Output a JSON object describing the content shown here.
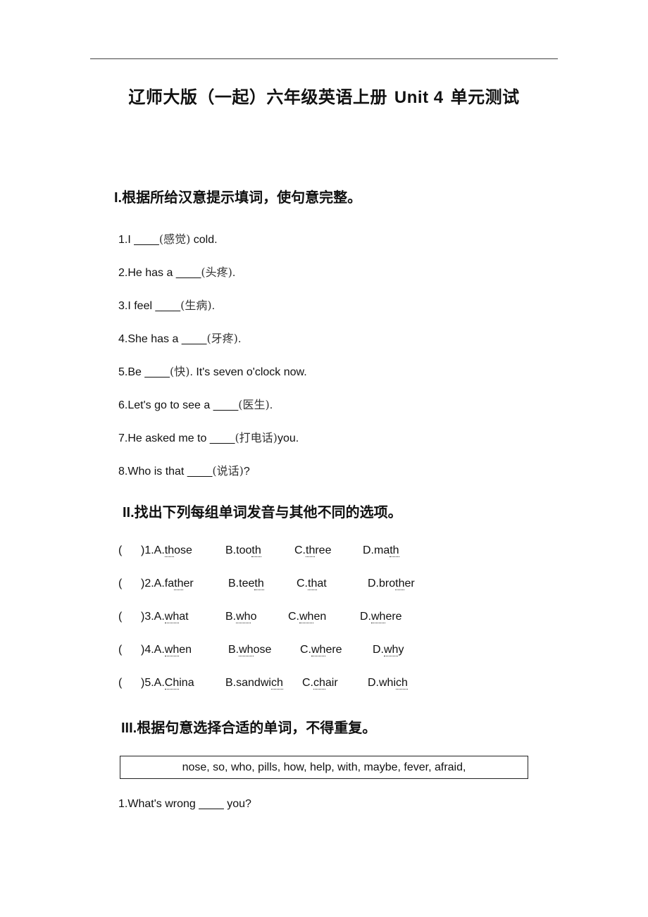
{
  "title": {
    "prefix": "辽师大版（一起）六年级英语上册",
    "unit": "Unit 4",
    "suffix": "单元测试"
  },
  "section1": {
    "heading": "I.根据所给汉意提示填词，使句意完整。",
    "items": [
      {
        "before": "1.I ____",
        "hint": "(感觉)",
        "after": " cold."
      },
      {
        "before": "2.He has a ____",
        "hint": "(头疼)",
        "after": "."
      },
      {
        "before": "3.I feel ____",
        "hint": "(生病)",
        "after": "."
      },
      {
        "before": "4.She has a ____",
        "hint": "(牙疼)",
        "after": "."
      },
      {
        "before": "5.Be ____",
        "hint": "(快)",
        "after": ". It's seven o'clock now."
      },
      {
        "before": "6.Let's go to see a ____",
        "hint": "(医生)",
        "after": "."
      },
      {
        "before": "7.He asked me to ____",
        "hint": "(打电话)",
        "after": "you."
      },
      {
        "before": "8.Who is that ____",
        "hint": "(说话)",
        "after": "?"
      }
    ]
  },
  "section2": {
    "heading": "II.找出下列每组单词发音与其他不同的选项。",
    "bracket_open": "(",
    "questions": [
      {
        "num": ")1.",
        "options": [
          {
            "letter": "A.",
            "pre": "",
            "seg": "th",
            "post": "ose"
          },
          {
            "letter": "B.",
            "pre": "too",
            "seg": "th",
            "post": ""
          },
          {
            "letter": "C.",
            "pre": "",
            "seg": "th",
            "post": "ree"
          },
          {
            "letter": "D.",
            "pre": "ma",
            "seg": "th",
            "post": ""
          }
        ]
      },
      {
        "num": ")2.",
        "options": [
          {
            "letter": "A.",
            "pre": "fa",
            "seg": "th",
            "post": "er"
          },
          {
            "letter": "B.",
            "pre": "tee",
            "seg": "th",
            "post": ""
          },
          {
            "letter": "C.",
            "pre": "",
            "seg": "th",
            "post": "at"
          },
          {
            "letter": "D.",
            "pre": "bro",
            "seg": "th",
            "post": "er"
          }
        ]
      },
      {
        "num": ")3.",
        "options": [
          {
            "letter": "A.",
            "pre": "",
            "seg": "wh",
            "post": "at"
          },
          {
            "letter": "B.",
            "pre": "",
            "seg": "wh",
            "post": "o"
          },
          {
            "letter": "C.",
            "pre": "",
            "seg": "wh",
            "post": "en"
          },
          {
            "letter": "D.",
            "pre": "",
            "seg": "wh",
            "post": "ere"
          }
        ]
      },
      {
        "num": ")4.",
        "options": [
          {
            "letter": "A.",
            "pre": "",
            "seg": "wh",
            "post": "en"
          },
          {
            "letter": "B.",
            "pre": "",
            "seg": "wh",
            "post": "ose"
          },
          {
            "letter": "C.",
            "pre": "",
            "seg": "wh",
            "post": "ere"
          },
          {
            "letter": "D.",
            "pre": "",
            "seg": "wh",
            "post": "y"
          }
        ]
      },
      {
        "num": ")5.",
        "options": [
          {
            "letter": "A.",
            "pre": "",
            "seg": "Ch",
            "post": "ina"
          },
          {
            "letter": "B.",
            "pre": "sandwi",
            "seg": "ch",
            "post": ""
          },
          {
            "letter": "C.",
            "pre": "",
            "seg": "ch",
            "post": "air"
          },
          {
            "letter": "D.",
            "pre": "whi",
            "seg": "ch",
            "post": ""
          }
        ]
      }
    ]
  },
  "section3": {
    "heading": "III.根据句意选择合适的单词，不得重复。",
    "word_box": "nose, so, who, pills, how, help, with, maybe, fever, afraid,",
    "items": [
      {
        "text": "1.What's wrong ____ you?"
      }
    ]
  }
}
